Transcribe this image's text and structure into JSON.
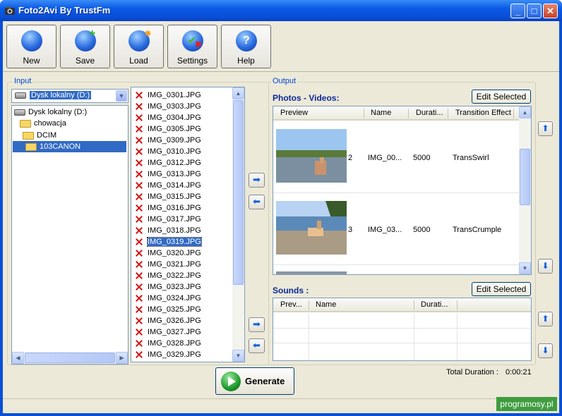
{
  "window": {
    "title": "Foto2Avi By TrustFm",
    "min": "_",
    "max": "□",
    "close": "✕"
  },
  "toolbar": [
    {
      "label": "New",
      "icon": "new-icon"
    },
    {
      "label": "Save",
      "icon": "save-icon"
    },
    {
      "label": "Load",
      "icon": "load-icon"
    },
    {
      "label": "Settings",
      "icon": "settings-icon"
    },
    {
      "label": "Help",
      "icon": "help-icon"
    }
  ],
  "input": {
    "group_label": "Input",
    "drive_selected": "Dysk lokalny (D:)",
    "tree": [
      {
        "label": "Dysk lokalny (D:)",
        "type": "drive",
        "level": 0
      },
      {
        "label": "chowacja",
        "type": "folder",
        "level": 1
      },
      {
        "label": "DCIM",
        "type": "folder",
        "level": 2
      },
      {
        "label": "103CANON",
        "type": "folder",
        "level": 3,
        "selected": true
      }
    ],
    "files": [
      "IMG_0301.JPG",
      "IMG_0303.JPG",
      "IMG_0304.JPG",
      "IMG_0305.JPG",
      "IMG_0309.JPG",
      "IMG_0310.JPG",
      "IMG_0312.JPG",
      "IMG_0313.JPG",
      "IMG_0314.JPG",
      "IMG_0315.JPG",
      "IMG_0316.JPG",
      "IMG_0317.JPG",
      "IMG_0318.JPG",
      "IMG_0319.JPG",
      "IMG_0320.JPG",
      "IMG_0321.JPG",
      "IMG_0322.JPG",
      "IMG_0323.JPG",
      "IMG_0324.JPG",
      "IMG_0325.JPG",
      "IMG_0326.JPG",
      "IMG_0327.JPG",
      "IMG_0328.JPG",
      "IMG_0329.JPG"
    ],
    "selected_file": "IMG_0319.JPG"
  },
  "output": {
    "group_label": "Output",
    "photos_label": "Photos - Videos:",
    "edit_selected": "Edit Selected",
    "photo_columns": [
      "Preview",
      "Name",
      "Durati...",
      "Transition Effect"
    ],
    "photos": [
      {
        "index": "2",
        "name": "IMG_00...",
        "duration": "5000",
        "effect": "TransSwirl"
      },
      {
        "index": "3",
        "name": "IMG_03...",
        "duration": "5000",
        "effect": "TransCrumple"
      }
    ],
    "sounds_label": "Sounds :",
    "sounds_edit": "Edit Selected",
    "sound_columns": [
      "Prev...",
      "Name",
      "Durati..."
    ],
    "total_label": "Total Duration :",
    "total_value": "0:00:21"
  },
  "generate": "Generate",
  "watermark": "programosy.pl",
  "colors": {
    "title_bar": "#0a4fd8",
    "selection": "#316ac5",
    "panel": "#ece9d8",
    "section_title": "#0a2a9a"
  }
}
